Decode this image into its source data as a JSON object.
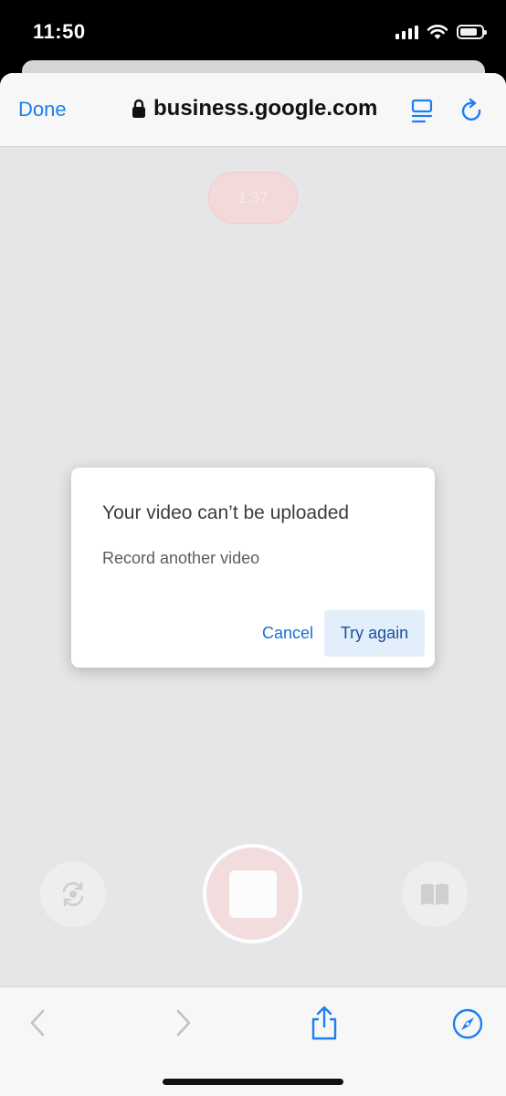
{
  "status_bar": {
    "time": "11:50"
  },
  "browser": {
    "done_label": "Done",
    "url": "business.google.com"
  },
  "recorder": {
    "timer": "1:37"
  },
  "dialog": {
    "title": "Your video can’t be uploaded",
    "body": "Record another video",
    "cancel_label": "Cancel",
    "try_again_label": "Try again"
  },
  "colors": {
    "accent": "#1a7ff2",
    "dialog_link": "#1a6fd0",
    "primary_button_bg": "#e3eefb",
    "record_tint": "#f2dcdd"
  },
  "icons": {
    "status": [
      "signal-icon",
      "wifi-icon",
      "battery-icon"
    ],
    "nav": [
      "lock-icon",
      "reader-icon",
      "reload-icon"
    ],
    "toolbar": [
      "back-icon",
      "forward-icon",
      "share-icon",
      "compass-icon"
    ],
    "camera": [
      "flip-camera-icon",
      "stop-icon",
      "book-icon"
    ]
  }
}
